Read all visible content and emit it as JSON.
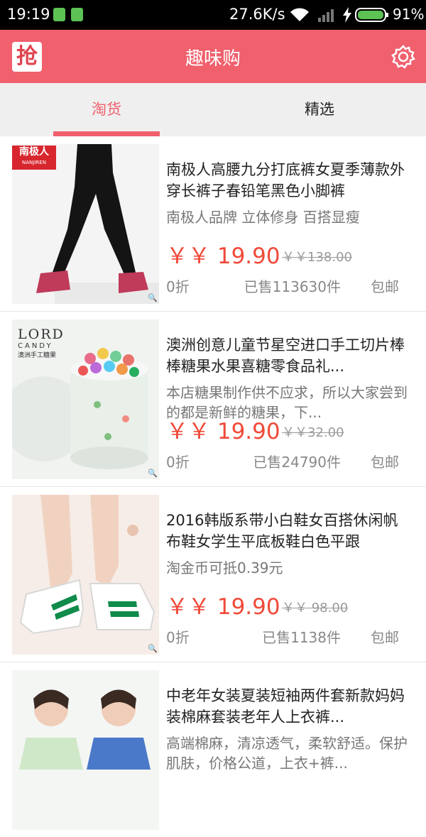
{
  "status_bar": {
    "time": "19:19",
    "net_speed": "27.6K/s",
    "battery": "91%"
  },
  "app_bar": {
    "logo_text": "抢",
    "title": "趣味购"
  },
  "tabs": [
    {
      "label": "淘货",
      "selected": true
    },
    {
      "label": "精选",
      "selected": false
    }
  ],
  "products": [
    {
      "image_label": "南极人",
      "image_sublabel": "NANJIREN",
      "title": "南极人高腰九分打底裤女夏季薄款外穿长裤子春铅笔黑色小脚裤",
      "description": "南极人品牌 立体修身 百搭显瘦",
      "price": "￥￥ 19.90",
      "original_price": "￥￥138.00",
      "discount": "0折",
      "sold": "已售113630件",
      "shipping": "包邮"
    },
    {
      "image_label": "LORD",
      "image_sublabel": "CANDY",
      "image_caption": "澳洲手工糖果",
      "title": "澳洲创意儿童节星空进口手工切片棒棒糖果水果喜糖零食品礼...",
      "description": "本店糖果制作供不应求，所以大家尝到的都是新鲜的糖果，下...",
      "price": "￥￥ 19.90",
      "original_price": "￥￥32.00",
      "discount": "0折",
      "sold": "已售24790件",
      "shipping": "包邮"
    },
    {
      "title": "2016韩版系带小白鞋女百搭休闲帆布鞋女学生平底板鞋白色平跟",
      "description": "淘金币可抵0.39元",
      "price": "￥￥ 19.90",
      "original_price": "￥￥ 98.00",
      "discount": "0折",
      "sold": "已售1138件",
      "shipping": "包邮"
    },
    {
      "title": "中老年女装夏装短袖两件套新款妈妈装棉麻套装老年人上衣裤...",
      "description": "高端棉麻，清凉透气，柔软舒适。保护肌肤，价格公道，上衣+裤..."
    }
  ],
  "colors": {
    "accent": "#f0606d",
    "price": "#f04a39"
  }
}
